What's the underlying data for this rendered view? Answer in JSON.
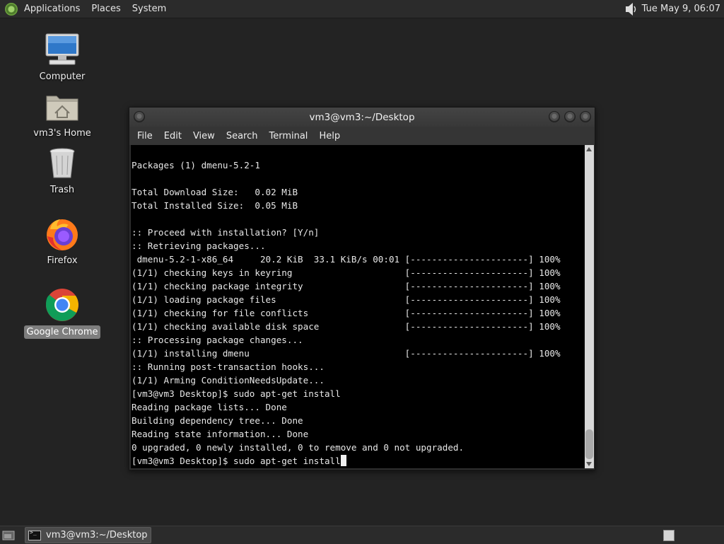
{
  "top_panel": {
    "menus": [
      "Applications",
      "Places",
      "System"
    ],
    "clock": "Tue May  9, 06:07",
    "icons": {
      "logo": "distro-logo-icon",
      "volume": "speaker-icon"
    }
  },
  "desktop": {
    "icons": [
      {
        "label": "Computer",
        "icon": "computer-icon"
      },
      {
        "label": "vm3's Home",
        "icon": "home-folder-icon"
      },
      {
        "label": "Trash",
        "icon": "trash-icon"
      },
      {
        "label": "Firefox",
        "icon": "firefox-icon"
      },
      {
        "label": "Google Chrome",
        "icon": "chrome-icon",
        "selected": true
      }
    ]
  },
  "terminal": {
    "title": "vm3@vm3:~/Desktop",
    "menu": [
      "File",
      "Edit",
      "View",
      "Search",
      "Terminal",
      "Help"
    ],
    "lines": [
      "",
      "Packages (1) dmenu-5.2-1",
      "",
      "Total Download Size:   0.02 MiB",
      "Total Installed Size:  0.05 MiB",
      "",
      ":: Proceed with installation? [Y/n]",
      ":: Retrieving packages...",
      " dmenu-5.2-1-x86_64     20.2 KiB  33.1 KiB/s 00:01 [----------------------] 100%",
      "(1/1) checking keys in keyring                     [----------------------] 100%",
      "(1/1) checking package integrity                   [----------------------] 100%",
      "(1/1) loading package files                        [----------------------] 100%",
      "(1/1) checking for file conflicts                  [----------------------] 100%",
      "(1/1) checking available disk space                [----------------------] 100%",
      ":: Processing package changes...",
      "(1/1) installing dmenu                             [----------------------] 100%",
      ":: Running post-transaction hooks...",
      "(1/1) Arming ConditionNeedsUpdate...",
      "[vm3@vm3 Desktop]$ sudo apt-get install",
      "Reading package lists... Done",
      "Building dependency tree... Done",
      "Reading state information... Done",
      "0 upgraded, 0 newly installed, 0 to remove and 0 not upgraded."
    ],
    "prompt_line": "[vm3@vm3 Desktop]$ sudo apt-get install"
  },
  "bottom_panel": {
    "task_label": "vm3@vm3:~/Desktop",
    "icons": {
      "show_desktop": "show-desktop-icon",
      "task": "terminal-icon",
      "workspace": "workspace-switcher-icon"
    }
  }
}
